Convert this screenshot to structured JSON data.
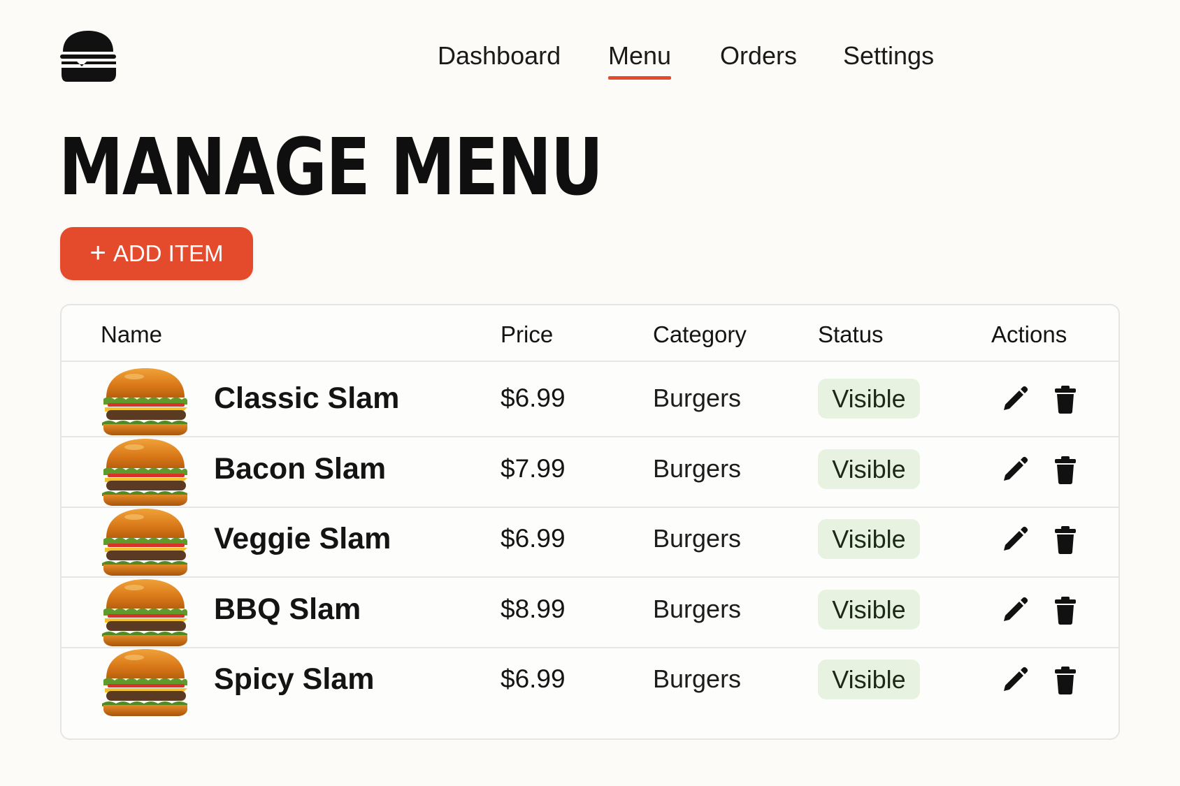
{
  "brand": {
    "logo_icon": "burger-icon"
  },
  "nav": {
    "items": [
      {
        "label": "Dashboard",
        "active": false
      },
      {
        "label": "Menu",
        "active": true
      },
      {
        "label": "Orders",
        "active": false
      },
      {
        "label": "Settings",
        "active": false
      }
    ]
  },
  "page": {
    "title": "MANAGE MENU",
    "add_button": {
      "icon": "plus-icon",
      "label": "ADD ITEM"
    }
  },
  "table": {
    "columns": [
      "Name",
      "Price",
      "Category",
      "Status",
      "Actions"
    ],
    "rows": [
      {
        "name": "Classic Slam",
        "price": "$6.99",
        "category": "Burgers",
        "status": "Visible"
      },
      {
        "name": "Bacon Slam",
        "price": "$7.99",
        "category": "Burgers",
        "status": "Visible"
      },
      {
        "name": "Veggie Slam",
        "price": "$6.99",
        "category": "Burgers",
        "status": "Visible"
      },
      {
        "name": "BBQ Slam",
        "price": "$8.99",
        "category": "Burgers",
        "status": "Visible"
      },
      {
        "name": "Spicy Slam",
        "price": "$6.99",
        "category": "Burgers",
        "status": "Visible"
      }
    ],
    "action_icons": [
      "pencil-icon",
      "trash-icon"
    ]
  },
  "colors": {
    "accent": "#e44a2c",
    "badge_bg": "#e7f2e1",
    "background": "#fcfbf8"
  }
}
